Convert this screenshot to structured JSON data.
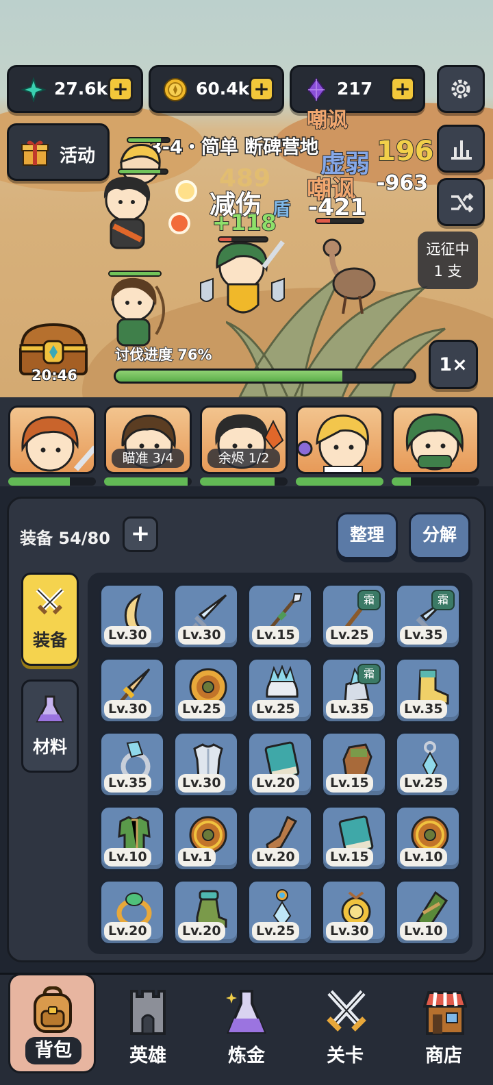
{
  "currency": {
    "crystal": {
      "value": "27.6k",
      "icon": "crystal-icon",
      "color": "#3ad0b0"
    },
    "gold": {
      "value": "60.4k",
      "icon": "coin-icon",
      "color": "#f0b82a"
    },
    "gem": {
      "value": "217",
      "icon": "purple-gem-icon",
      "color": "#8a4fd8"
    }
  },
  "activity": {
    "label": "活动"
  },
  "stage": {
    "title": "3-4・简单 断碑营地"
  },
  "expedition": {
    "line1": "远征中",
    "line2": "1 支"
  },
  "chest": {
    "timer": "20:46"
  },
  "progress": {
    "label": "讨伐进度 76%",
    "value": 0.76
  },
  "speed": {
    "label": "1×"
  },
  "floating_text": {
    "t1": "嘲讽",
    "t2": "虚弱",
    "t3": "196",
    "t4": "嘲讽",
    "t5": "-963",
    "t6": "-421",
    "t7": "减伤",
    "t8": "盾",
    "t9": "+118",
    "t10": "489"
  },
  "party": [
    {
      "tag": "",
      "hp": 0.7
    },
    {
      "tag": "瞄准 3/4",
      "hp": 0.95
    },
    {
      "tag": "余烬 1/2",
      "hp": 0.85
    },
    {
      "tag": "",
      "hp": 1.0
    },
    {
      "tag": "",
      "hp": 0.22
    }
  ],
  "inventory": {
    "header": "装备 54/80",
    "sort_label": "整理",
    "salvage_label": "分解",
    "tabs": {
      "equipment": "装备",
      "materials": "材料"
    },
    "frost_tag": "霜",
    "items": [
      {
        "lv": "Lv.30",
        "icon": "crescent-blade-icon",
        "frost": false
      },
      {
        "lv": "Lv.30",
        "icon": "ice-sword-icon",
        "frost": false
      },
      {
        "lv": "Lv.15",
        "icon": "spear-icon",
        "frost": false
      },
      {
        "lv": "Lv.25",
        "icon": "staff-icon",
        "frost": true
      },
      {
        "lv": "Lv.35",
        "icon": "frost-sword-icon",
        "frost": true
      },
      {
        "lv": "Lv.30",
        "icon": "golden-dagger-icon",
        "frost": false
      },
      {
        "lv": "Lv.25",
        "icon": "round-shield-icon",
        "frost": false
      },
      {
        "lv": "Lv.25",
        "icon": "crystal-helmet-icon",
        "frost": false
      },
      {
        "lv": "Lv.35",
        "icon": "crystal-gauntlet-icon",
        "frost": true
      },
      {
        "lv": "Lv.35",
        "icon": "golden-boots-icon",
        "frost": false
      },
      {
        "lv": "Lv.35",
        "icon": "crystal-ring-icon",
        "frost": false
      },
      {
        "lv": "Lv.30",
        "icon": "silver-armor-icon",
        "frost": false
      },
      {
        "lv": "Lv.20",
        "icon": "teal-tome-icon",
        "frost": false
      },
      {
        "lv": "Lv.15",
        "icon": "leather-glove-icon",
        "frost": false
      },
      {
        "lv": "Lv.25",
        "icon": "pendant-icon",
        "frost": false
      },
      {
        "lv": "Lv.10",
        "icon": "green-tunic-icon",
        "frost": false
      },
      {
        "lv": "Lv.1",
        "icon": "wooden-shield-icon",
        "frost": false
      },
      {
        "lv": "Lv.20",
        "icon": "leather-boot-icon",
        "frost": false
      },
      {
        "lv": "Lv.15",
        "icon": "teal-tome-icon",
        "frost": false
      },
      {
        "lv": "Lv.10",
        "icon": "wooden-shield-icon",
        "frost": false
      },
      {
        "lv": "Lv.20",
        "icon": "emerald-ring-icon",
        "frost": false
      },
      {
        "lv": "Lv.20",
        "icon": "green-boots-icon",
        "frost": false
      },
      {
        "lv": "Lv.25",
        "icon": "gem-amulet-icon",
        "frost": false
      },
      {
        "lv": "Lv.30",
        "icon": "sun-amulet-icon",
        "frost": false
      },
      {
        "lv": "Lv.10",
        "icon": "green-bracer-icon",
        "frost": false
      }
    ]
  },
  "nav": {
    "bag": "背包",
    "heroes": "英雄",
    "alchemy": "炼金",
    "stage": "关卡",
    "shop": "商店"
  }
}
